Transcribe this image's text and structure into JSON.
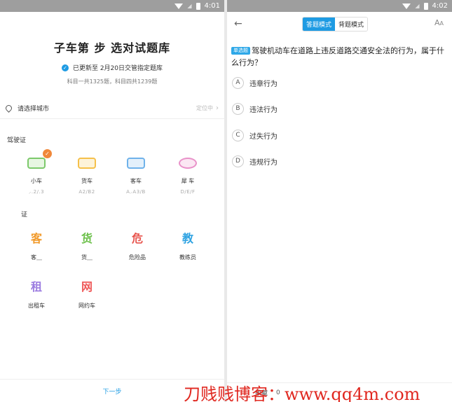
{
  "left": {
    "status_time": "4:01",
    "title": "子车第 步 选对试题库",
    "updated_text": "已更新至 2月20日交管指定题库",
    "counts_text": "科目一共1325题，科目四共1239题",
    "city": {
      "label": "请选择城市",
      "status": "定位中"
    },
    "license_section": "驾驶证",
    "vehicles": [
      {
        "name": "小车",
        "code": "⸝.2/.3",
        "color": "#7cc96b"
      },
      {
        "name": "货车",
        "code": "A2/B2",
        "color": "#f5c04a"
      },
      {
        "name": "客车",
        "code": "A⸝A3/B",
        "color": "#6fb2ea"
      },
      {
        "name": "犀 车",
        "code": "D/E/F",
        "color": "#e991c9"
      }
    ],
    "cert_section": "证",
    "certs": [
      {
        "glyph": "客",
        "name": "客⸏",
        "color": "#f19a2b"
      },
      {
        "glyph": "货",
        "name": "货⸏",
        "color": "#6cc04a"
      },
      {
        "glyph": "危",
        "name": "危险品",
        "color": "#e8554e"
      },
      {
        "glyph": "教",
        "name": "教练员",
        "color": "#2fa3e2"
      },
      {
        "glyph": "租",
        "name": "出租车",
        "color": "#9b7be0"
      },
      {
        "glyph": "网",
        "name": "网约车",
        "color": "#ef5a5a"
      }
    ],
    "next_label": "下一步"
  },
  "right": {
    "status_time": "4:02",
    "mode_answer": "答题模式",
    "mode_memorize": "背题模式",
    "question_tag": "单选题",
    "question_text": "驾驶机动车在道路上违反道路交通安全法的行为，属于什么行为？",
    "options": [
      {
        "letter": "A",
        "text": "违章行为"
      },
      {
        "letter": "B",
        "text": "违法行为"
      },
      {
        "letter": "C",
        "text": "过失行为"
      },
      {
        "letter": "D",
        "text": "违规行为"
      }
    ],
    "bottom_fav": "收藏",
    "bottom_count": "0"
  },
  "watermark": "刀贱贱博客：www.qq4m.com",
  "accent": "#1e9be3"
}
